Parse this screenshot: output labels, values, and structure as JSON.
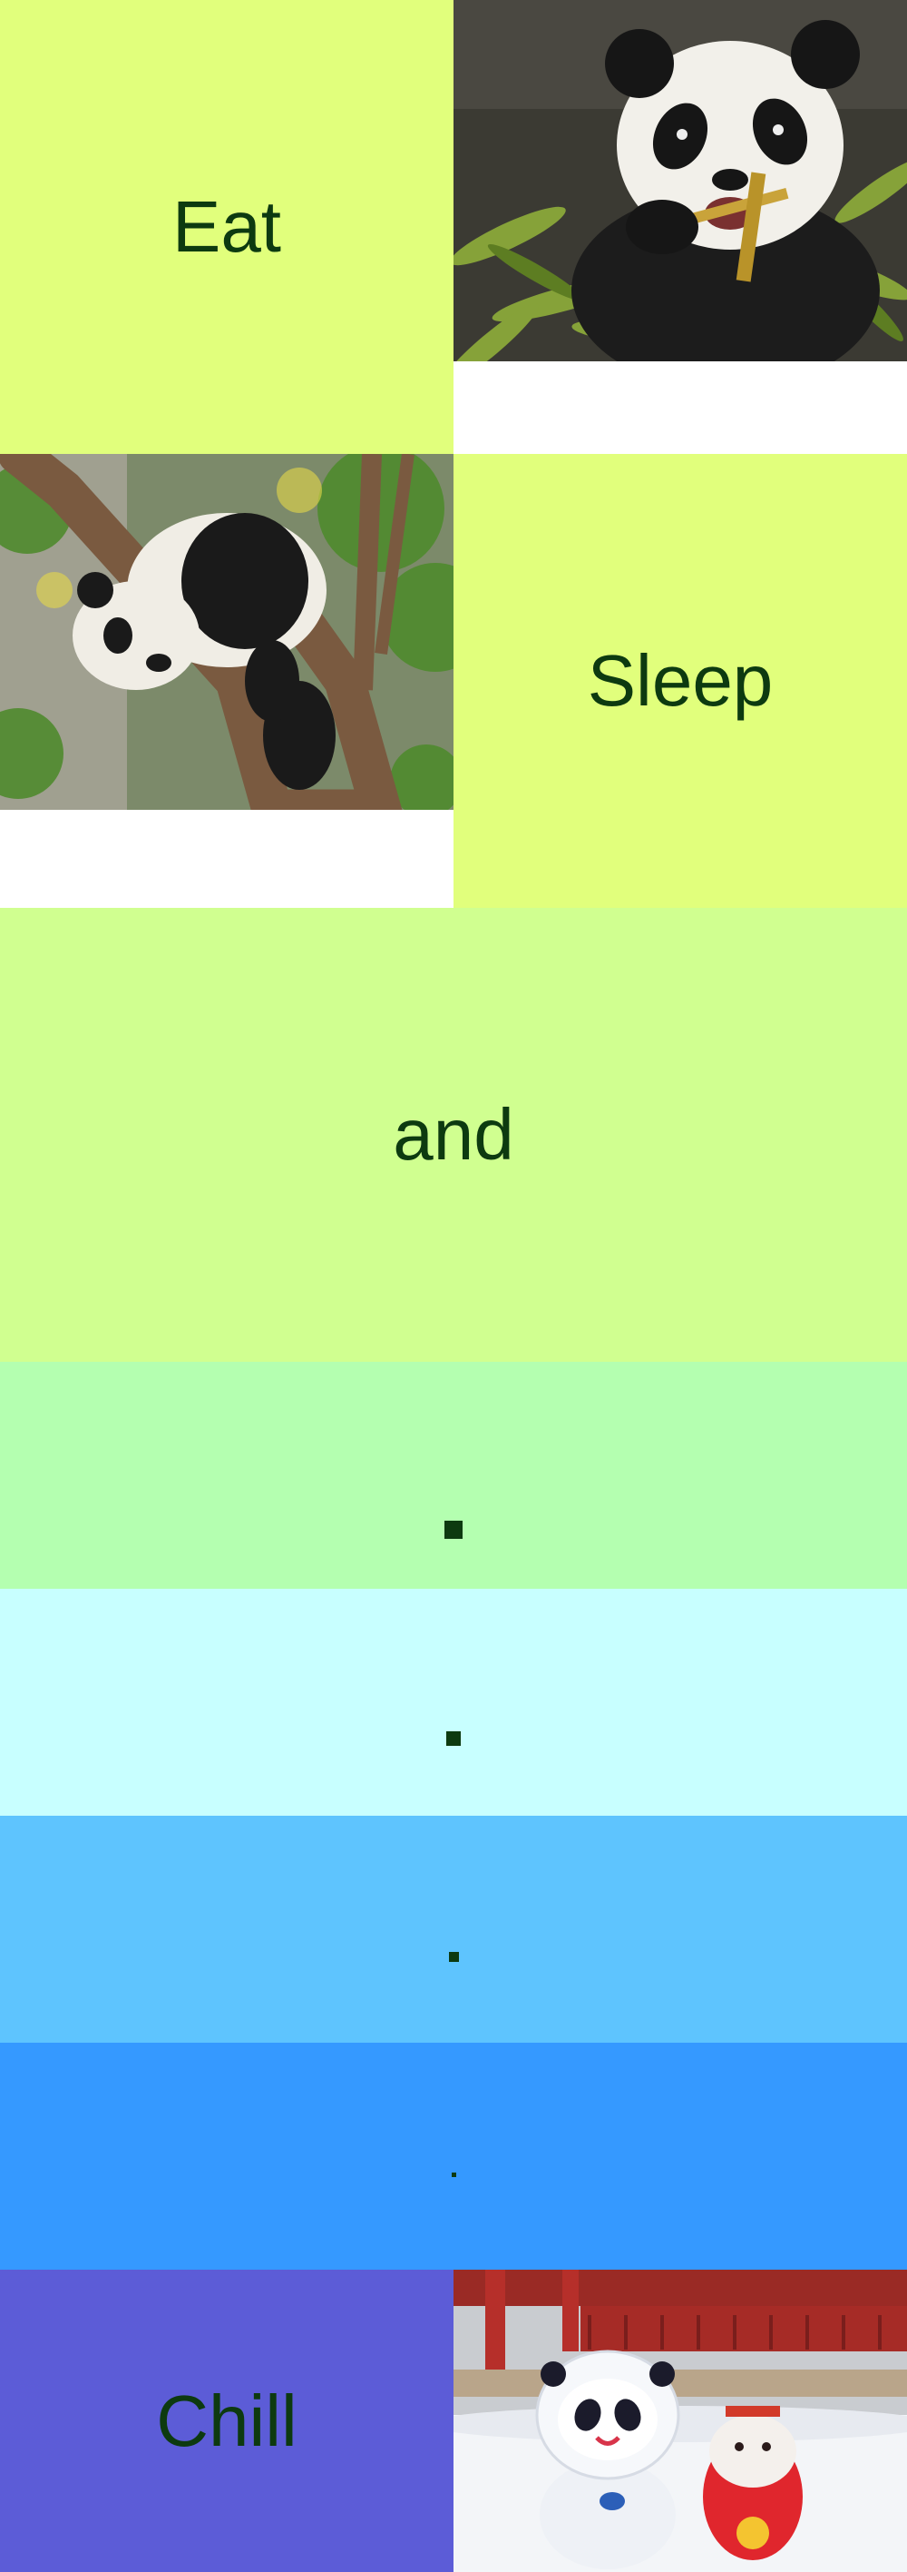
{
  "tiles": {
    "eat": "Eat",
    "sleep": "Sleep",
    "and": "and",
    "chill": "Chill"
  },
  "photos": {
    "eating_panda": "panda-eating-bamboo-photo",
    "sleeping_panda": "panda-sleeping-on-branch-photo",
    "mascots": "mascot-plush-toys-in-snow-photo"
  },
  "colors": {
    "eat_tile": "#e1ff7c",
    "sleep_tile": "#e1ff7c",
    "and_tile": "#d0ff90",
    "band_1": "#b4ffb0",
    "band_2": "#c8ffff",
    "band_3": "#5ec4fe",
    "band_4": "#3599ff",
    "chill_tile": "#5c5cd7",
    "text": "#0d3a10"
  },
  "dots": [
    "square-dot-large",
    "square-dot-medium",
    "square-dot-small",
    "square-dot-tiny"
  ]
}
